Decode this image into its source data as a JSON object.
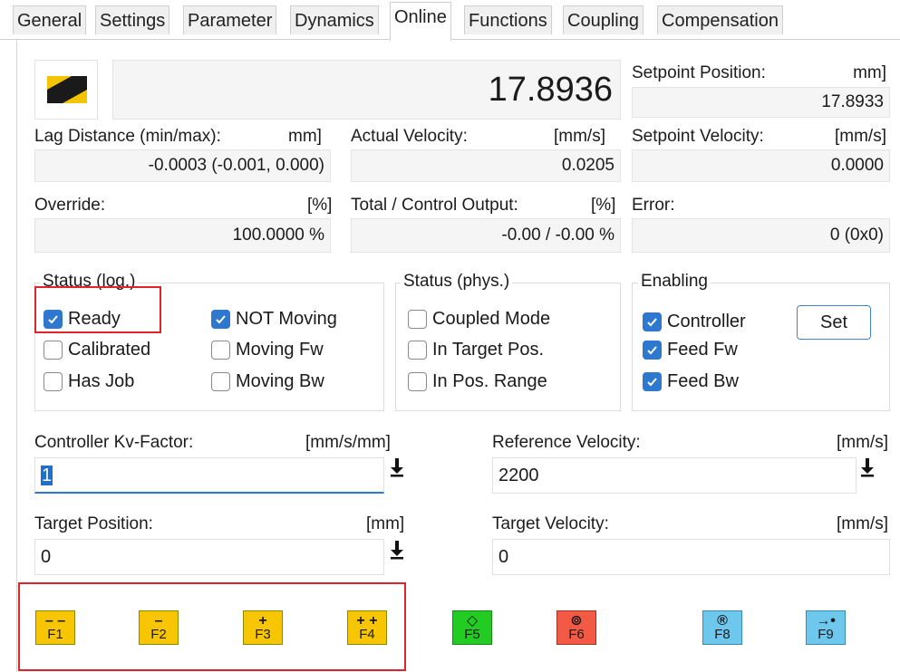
{
  "tabs": [
    "General",
    "Settings",
    "Parameter",
    "Dynamics",
    "Online",
    "Functions",
    "Coupling",
    "Compensation"
  ],
  "active_tab": "Online",
  "position": {
    "actual": "17.8936"
  },
  "setpoint_position": {
    "label": "Setpoint Position:",
    "unit": "mm]",
    "value": "17.8933"
  },
  "lag_distance": {
    "label": "Lag Distance (min/max):",
    "unit": "mm]",
    "value": "-0.0003  (-0.001, 0.000)"
  },
  "actual_velocity": {
    "label": "Actual Velocity:",
    "unit": "[mm/s]",
    "value": "0.0205"
  },
  "setpoint_velocity": {
    "label": "Setpoint Velocity:",
    "unit": "[mm/s]",
    "value": "0.0000"
  },
  "override": {
    "label": "Override:",
    "unit": "[%]",
    "value": "100.0000 %"
  },
  "total_output": {
    "label": "Total / Control Output:",
    "unit": "[%]",
    "value": "-0.00 / -0.00 %"
  },
  "error": {
    "label": "Error:",
    "value": "0 (0x0)"
  },
  "status_log": {
    "title": "Status (log.)",
    "items": [
      {
        "label": "Ready",
        "checked": true
      },
      {
        "label": "Calibrated",
        "checked": false
      },
      {
        "label": "Has Job",
        "checked": false
      },
      {
        "label": "NOT Moving",
        "checked": true
      },
      {
        "label": "Moving Fw",
        "checked": false
      },
      {
        "label": "Moving Bw",
        "checked": false
      }
    ]
  },
  "status_phys": {
    "title": "Status (phys.)",
    "items": [
      {
        "label": "Coupled Mode",
        "checked": false
      },
      {
        "label": "In Target Pos.",
        "checked": false
      },
      {
        "label": "In Pos. Range",
        "checked": false
      }
    ]
  },
  "enabling": {
    "title": "Enabling",
    "items": [
      {
        "label": "Controller",
        "checked": true
      },
      {
        "label": "Feed Fw",
        "checked": true
      },
      {
        "label": "Feed Bw",
        "checked": true
      }
    ],
    "set_label": "Set"
  },
  "kv_factor": {
    "label": "Controller Kv-Factor:",
    "unit": "[mm/s/mm]",
    "value": "1"
  },
  "reference_velocity": {
    "label": "Reference Velocity:",
    "unit": "[mm/s]",
    "value": "2200"
  },
  "target_position": {
    "label": "Target Position:",
    "unit": "[mm]",
    "value": "0"
  },
  "target_velocity": {
    "label": "Target Velocity:",
    "unit": "[mm/s]",
    "value": "0"
  },
  "fkeys": [
    {
      "fn": "F1",
      "sym": "– –",
      "color": "#f7c600"
    },
    {
      "fn": "F2",
      "sym": "–",
      "color": "#f7c600"
    },
    {
      "fn": "F3",
      "sym": "+",
      "color": "#f7c600"
    },
    {
      "fn": "F4",
      "sym": "+ +",
      "color": "#f7c600"
    },
    {
      "fn": "F5",
      "sym": "◇",
      "color": "#22cc22"
    },
    {
      "fn": "F6",
      "sym": "⊚",
      "color": "#f25a45"
    },
    {
      "fn": "F8",
      "sym": "®",
      "color": "#6ec8ee"
    },
    {
      "fn": "F9",
      "sym": "→•",
      "color": "#6ec8ee"
    }
  ],
  "colors": {
    "accent": "#2f78d0",
    "highlight_border": "#e0242b"
  }
}
